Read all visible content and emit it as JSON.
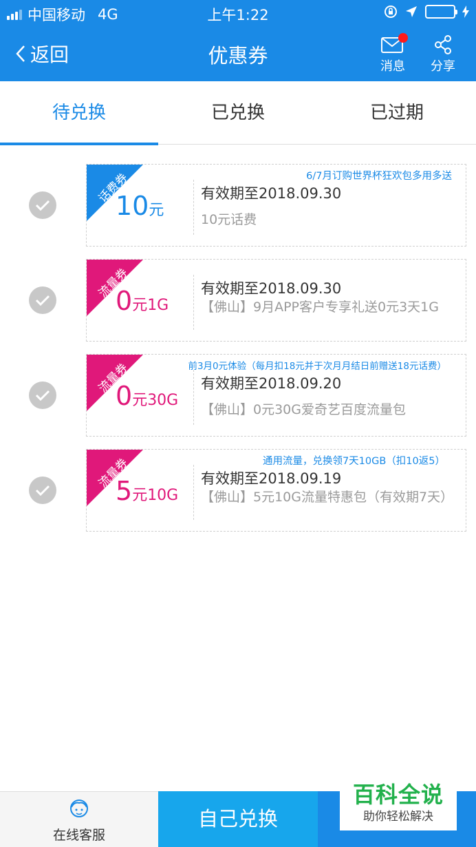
{
  "status_bar": {
    "carrier": "中国移动",
    "network": "4G",
    "time": "上午1:22"
  },
  "nav": {
    "back_label": "返回",
    "title": "优惠券",
    "message_label": "消息",
    "share_label": "分享"
  },
  "tabs": [
    {
      "label": "待兑换",
      "active": true
    },
    {
      "label": "已兑换",
      "active": false
    },
    {
      "label": "已过期",
      "active": false
    }
  ],
  "coupons": [
    {
      "type": "话费券",
      "amount": "10",
      "unit": "元",
      "note": "6/7月订购世界杯狂欢包多用多送",
      "valid": "有效期至2018.09.30",
      "desc": "10元话费",
      "color": "#1a8ae6"
    },
    {
      "type": "流量券",
      "amount": "0",
      "unit": "元1G",
      "note": "",
      "valid": "有效期至2018.09.30",
      "desc": "【佛山】9月APP客户专享礼送0元3天1G",
      "color": "#e0187a"
    },
    {
      "type": "流量券",
      "amount": "0",
      "unit": "元30G",
      "note": "前3月0元体验（每月扣18元并于次月月结日前赠送18元话费）",
      "valid": "有效期至2018.09.20",
      "desc": "【佛山】0元30G爱奇艺百度流量包",
      "color": "#e0187a"
    },
    {
      "type": "流量券",
      "amount": "5",
      "unit": "元10G",
      "note": "通用流量，兑换领7天10GB（扣10返5）",
      "valid": "有效期至2018.09.19",
      "desc": "【佛山】5元10G流量特惠包（有效期7天）",
      "color": "#e0187a"
    }
  ],
  "bottom": {
    "service_label": "在线客服",
    "redeem_label": "自己兑换"
  },
  "watermark": {
    "title": "百科全说",
    "subtitle": "助你轻松解决"
  },
  "colors": {
    "primary": "#1a8ae6",
    "flow": "#e0187a",
    "check": "#c8c8c8"
  }
}
